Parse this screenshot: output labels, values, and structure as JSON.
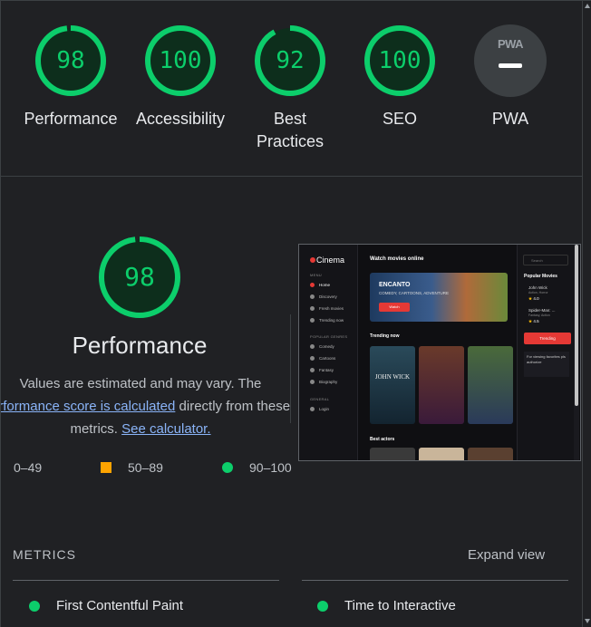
{
  "categories": [
    {
      "label": "Performance",
      "score": "98",
      "color": "#0cce6b"
    },
    {
      "label": "Accessibility",
      "score": "100",
      "color": "#0cce6b"
    },
    {
      "label": "Best Practices",
      "score": "92",
      "color": "#0cce6b"
    },
    {
      "label": "SEO",
      "score": "100",
      "color": "#0cce6b"
    },
    {
      "label": "PWA",
      "badge": "PWA"
    }
  ],
  "performance": {
    "score": "98",
    "title": "Performance",
    "desc_start": "Values are estimated and may vary. The",
    "link_score": "erformance score is calculated",
    "desc_mid": "directly from these",
    "desc_metrics": "metrics.",
    "link_calc": "See calculator."
  },
  "legend": {
    "fail": "0–49",
    "average": "50–89",
    "pass": "90–100"
  },
  "colors": {
    "pass": "#0cce6b",
    "average": "#ffa400",
    "fail": "#ff4e42",
    "link": "#8ab4f8"
  },
  "thumbnail": {
    "brand": "Cinema",
    "menu_label": "MENU",
    "menu": [
      "Home",
      "Discovery",
      "Fresh movies",
      "Trending now"
    ],
    "popular_label": "POPULAR GENRES",
    "genres": [
      "Comedy",
      "Cartoons",
      "Fantasy",
      "Biography"
    ],
    "general_label": "GENERAL",
    "general": [
      "Login"
    ],
    "header": "Watch movies online",
    "banner_title": "ENCANTO",
    "banner_sub": "COMEDY, CARTOONS, ADVENTURE",
    "banner_btn": "Watch",
    "trending": "Trending now",
    "card_label": "JOHN WICK",
    "best_actors": "Best actors",
    "search": "Search",
    "popular_movies": "Popular Movies",
    "movies": [
      {
        "title": "John Wick",
        "meta": "Action, Horror",
        "rating": "4.0"
      },
      {
        "title": "Spider-Man: ...",
        "meta": "Fantasy, Action",
        "rating": "4.5"
      }
    ],
    "trending_btn": "Trending",
    "note": "For viewing favorites pls authorize"
  },
  "metrics": {
    "title": "METRICS",
    "expand": "Expand view",
    "items": [
      "First Contentful Paint",
      "Time to Interactive"
    ]
  }
}
